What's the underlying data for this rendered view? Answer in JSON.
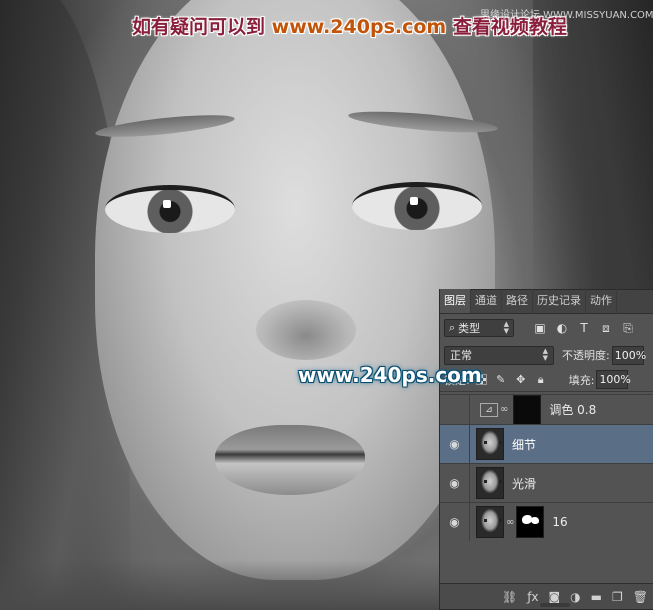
{
  "header": {
    "caption_prefix": "如有疑问可以到",
    "caption_site": "www.240ps.com",
    "caption_suffix": "查看视频教程",
    "corner_watermark": "思缘设计论坛 WWW.MISSYUAN.COM",
    "center_watermark": "www.240ps.com"
  },
  "layers_panel": {
    "tabs": [
      {
        "label": "图层",
        "active": true
      },
      {
        "label": "通道",
        "active": false
      },
      {
        "label": "路径",
        "active": false
      },
      {
        "label": "历史记录",
        "active": false
      },
      {
        "label": "动作",
        "active": false
      }
    ],
    "filter": {
      "label": "类型",
      "icon": "search-icon"
    },
    "blend_mode": "正常",
    "opacity_label": "不透明度:",
    "opacity_value": "100%",
    "lock_label": "锁定:",
    "fill_label": "填充:",
    "fill_value": "100%",
    "layers": [
      {
        "name": "调色 0.8",
        "type": "adjustment",
        "visible": false,
        "selected": false
      },
      {
        "name": "细节",
        "type": "image",
        "visible": true,
        "selected": true
      },
      {
        "name": "光滑",
        "type": "image",
        "visible": true,
        "selected": false
      },
      {
        "name": "16",
        "type": "image-with-mask",
        "visible": true,
        "selected": false
      }
    ],
    "colors": {
      "panel_bg": "#535353",
      "selected_row": "#5a6e86",
      "tab_bar": "#434343"
    }
  }
}
